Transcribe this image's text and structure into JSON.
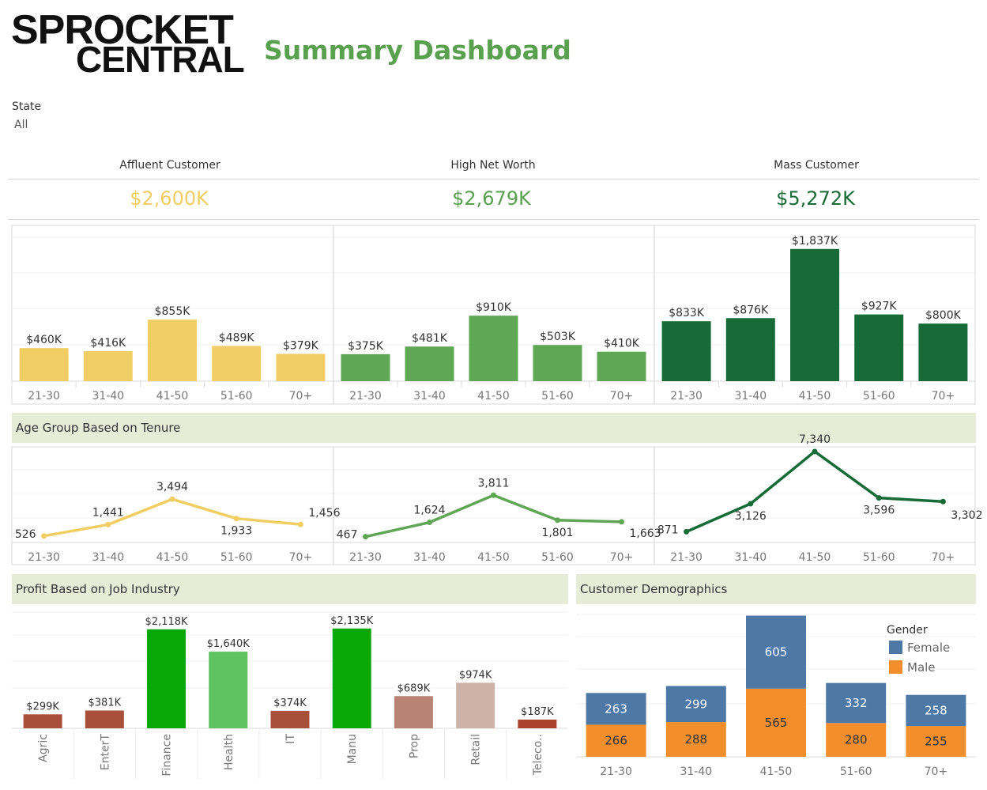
{
  "header": {
    "logo_line1": "SPROCKET",
    "logo_line2": "CENTRAL",
    "title": "Summary Dashboard"
  },
  "filter": {
    "label": "State",
    "value": "All"
  },
  "kpis": [
    {
      "name": "Affluent Customer",
      "value": "$2,600K",
      "color": "#f1ce63"
    },
    {
      "name": "High Net Worth",
      "value": "$2,679K",
      "color": "#59a14f"
    },
    {
      "name": "Mass Customer",
      "value": "$5,272K",
      "color": "#1a6b36"
    }
  ],
  "sections": {
    "tenure_title": "Age Group Based on Tenure",
    "industry_title": "Profit Based on Job Industry",
    "demographics_title": "Customer Demographics"
  },
  "chart_data": [
    {
      "type": "bar",
      "id": "profit-by-age-segment",
      "categories": [
        "21-30",
        "31-40",
        "41-50",
        "51-60",
        "70+"
      ],
      "series": [
        {
          "name": "Affluent Customer",
          "values": [
            460,
            416,
            855,
            489,
            379
          ],
          "labels": [
            "$460K",
            "$416K",
            "$855K",
            "$489K",
            "$379K"
          ],
          "color": "#f1ce63"
        },
        {
          "name": "High Net Worth",
          "values": [
            375,
            481,
            910,
            503,
            410
          ],
          "labels": [
            "$375K",
            "$481K",
            "$910K",
            "$503K",
            "$410K"
          ],
          "color": "#5fa655"
        },
        {
          "name": "Mass Customer",
          "values": [
            833,
            876,
            1837,
            927,
            800
          ],
          "labels": [
            "$833K",
            "$876K",
            "$1,837K",
            "$927K",
            "$800K"
          ],
          "color": "#166b37"
        }
      ],
      "ylim": [
        0,
        2000
      ],
      "grid": true
    },
    {
      "type": "line",
      "id": "tenure-by-age",
      "categories": [
        "21-30",
        "31-40",
        "41-50",
        "51-60",
        "70+"
      ],
      "series": [
        {
          "name": "Affluent Customer",
          "values": [
            526,
            1441,
            3494,
            1933,
            1456
          ],
          "labels": [
            "526",
            "1,441",
            "3,494",
            "1,933",
            "1,456"
          ],
          "color": "#f1ce63"
        },
        {
          "name": "High Net Worth",
          "values": [
            467,
            1624,
            3811,
            1801,
            1663
          ],
          "labels": [
            "467",
            "1,624",
            "3,811",
            "1,801",
            "1,663"
          ],
          "color": "#5fa655"
        },
        {
          "name": "Mass Customer",
          "values": [
            871,
            3126,
            7340,
            3596,
            3302
          ],
          "labels": [
            "871",
            "3,126",
            "7,340",
            "3,596",
            "3,302"
          ],
          "color": "#166b37"
        }
      ],
      "ylim": [
        0,
        7400
      ],
      "grid": true
    },
    {
      "type": "bar",
      "id": "profit-by-industry",
      "categories": [
        "Agric",
        "EnterT",
        "Finance",
        "Health",
        "IT",
        "Manu",
        "Prop",
        "Retail",
        "Teleco.."
      ],
      "values": [
        299,
        381,
        2118,
        1640,
        374,
        2135,
        689,
        974,
        187
      ],
      "labels": [
        "$299K",
        "$381K",
        "$2,118K",
        "$1,640K",
        "$374K",
        "$2,135K",
        "$689K",
        "$974K",
        "$187K"
      ],
      "colors": [
        "#a9503a",
        "#a9503a",
        "#08a808",
        "#5fc45f",
        "#a9503a",
        "#08a808",
        "#b98373",
        "#cdb2aa",
        "#a9432d"
      ],
      "ylim": [
        0,
        2300
      ],
      "grid": true
    },
    {
      "type": "bar",
      "stacked": true,
      "id": "customer-demographics",
      "categories": [
        "21-30",
        "31-40",
        "41-50",
        "51-60",
        "70+"
      ],
      "series": [
        {
          "name": "Male",
          "values": [
            266,
            288,
            565,
            280,
            255
          ],
          "color": "#f28e2b"
        },
        {
          "name": "Female",
          "values": [
            263,
            299,
            605,
            332,
            258
          ],
          "color": "#4e79a7"
        }
      ],
      "legend_title": "Gender",
      "legend": [
        "Female",
        "Male"
      ],
      "legend_position": "top-right",
      "ylim": [
        0,
        1180
      ]
    }
  ]
}
